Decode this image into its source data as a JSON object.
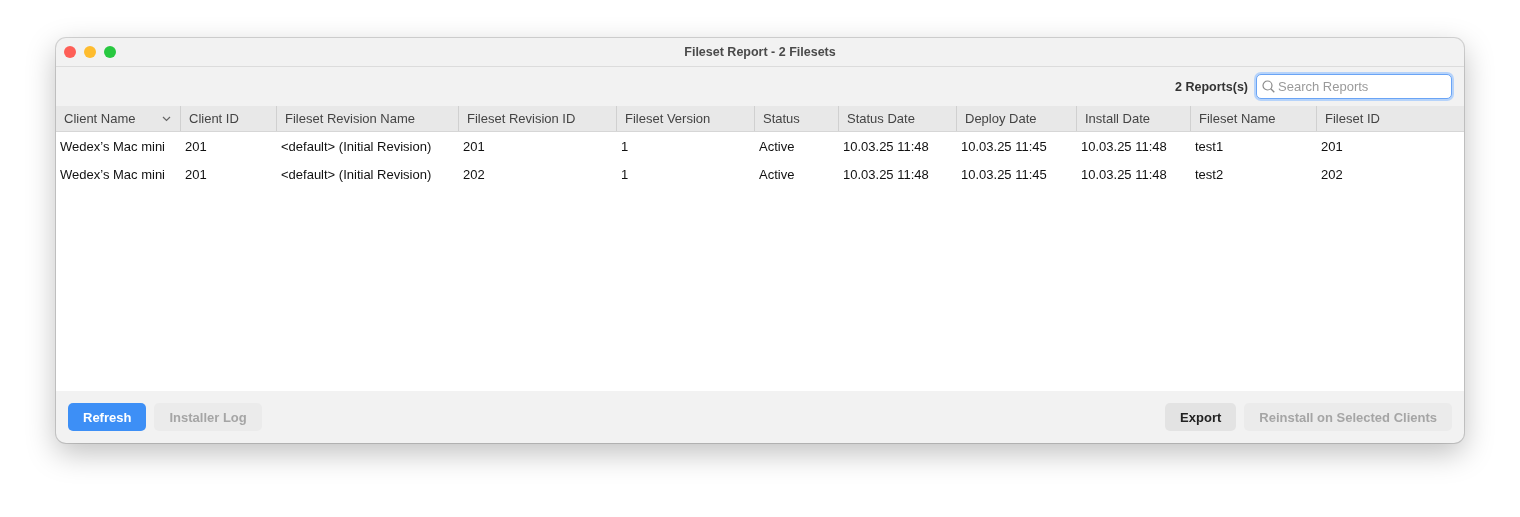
{
  "window": {
    "title": "Fileset Report - 2 Filesets"
  },
  "toolbar": {
    "count": "2 Reports(s)",
    "search": {
      "placeholder": "Search Reports",
      "focused": true
    }
  },
  "table": {
    "columns": [
      {
        "label": "Client Name",
        "sorted": true
      },
      {
        "label": "Client ID",
        "sorted": false
      },
      {
        "label": "Fileset Revision Name",
        "sorted": false
      },
      {
        "label": "Fileset Revision ID",
        "sorted": false
      },
      {
        "label": "Fileset Version",
        "sorted": false
      },
      {
        "label": "Status",
        "sorted": false
      },
      {
        "label": "Status Date",
        "sorted": false
      },
      {
        "label": "Deploy Date",
        "sorted": false
      },
      {
        "label": "Install Date",
        "sorted": false
      },
      {
        "label": "Fileset Name",
        "sorted": false
      },
      {
        "label": "Fileset ID",
        "sorted": false
      }
    ],
    "rows": [
      {
        "cells": [
          "Wedex’s Mac mini",
          "201",
          "<default> (Initial Revision)",
          "201",
          "1",
          "Active",
          "10.03.25 11:48",
          "10.03.25 11:45",
          "10.03.25 11:48",
          "test1",
          "201"
        ]
      },
      {
        "cells": [
          "Wedex’s Mac mini",
          "201",
          "<default> (Initial Revision)",
          "202",
          "1",
          "Active",
          "10.03.25 11:48",
          "10.03.25 11:45",
          "10.03.25 11:48",
          "test2",
          "202"
        ]
      }
    ]
  },
  "left_buttons": [
    {
      "label": "Refresh",
      "kind": "primary",
      "disabled": false
    },
    {
      "label": "Installer Log",
      "kind": "plain",
      "disabled": true
    }
  ],
  "right_buttons": [
    {
      "label": "Export",
      "kind": "plain",
      "disabled": false
    },
    {
      "label": "Reinstall on Selected Clients",
      "kind": "plain",
      "disabled": true
    }
  ]
}
